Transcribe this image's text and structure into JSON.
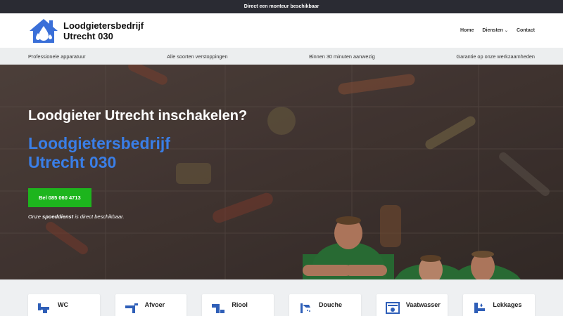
{
  "topbar": {
    "text": "Direct een monteur beschikbaar"
  },
  "header": {
    "logo_line1": "Loodgietersbedrijf",
    "logo_line2": "Utrecht 030",
    "nav": [
      {
        "label": "Home"
      },
      {
        "label": "Diensten"
      },
      {
        "label": "Contact"
      }
    ]
  },
  "usp": [
    {
      "text": "Professionele apparatuur"
    },
    {
      "text": "Alle soorten verstoppingen"
    },
    {
      "text": "Binnen 30 minuten aanwezig"
    },
    {
      "text": "Garantie op onze werkzaamheden"
    }
  ],
  "hero": {
    "title": "Loodgieter Utrecht inschakelen?",
    "subtitle": "Loodgietersbedrijf Utrecht 030",
    "cta_label": "Bel 085 060 4713",
    "note_prefix": "Onze",
    "note_bold": "spoeddienst",
    "note_suffix": "is direct beschikbaar."
  },
  "services": [
    {
      "label": "WC",
      "icon": "toilet-icon"
    },
    {
      "label": "Afvoer",
      "icon": "drain-icon"
    },
    {
      "label": "Riool",
      "icon": "sewer-pipe-icon"
    },
    {
      "label": "Douche",
      "icon": "shower-icon"
    },
    {
      "label": "Vaatwasser",
      "icon": "dishwasher-icon"
    },
    {
      "label": "Lekkages",
      "icon": "leak-pipe-icon"
    }
  ],
  "colors": {
    "accent_blue": "#3a7ee6",
    "cta_green": "#1db51d",
    "topbar_bg": "#2a2b33"
  }
}
